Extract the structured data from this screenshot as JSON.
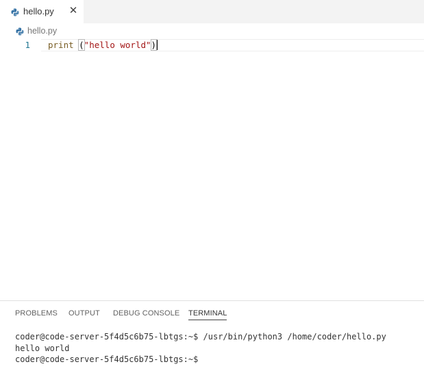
{
  "tab": {
    "filename": "hello.py",
    "close_glyph": "✕"
  },
  "breadcrumb": {
    "filename": "hello.py"
  },
  "editor": {
    "line_number": "1",
    "code": {
      "func": "print",
      "space": " ",
      "open_paren": "(",
      "string": "\"hello world\"",
      "close_paren": ")"
    }
  },
  "panel": {
    "tabs": [
      "PROBLEMS",
      "OUTPUT",
      "DEBUG CONSOLE",
      "TERMINAL"
    ],
    "active_tab": "TERMINAL"
  },
  "terminal": {
    "lines": [
      "coder@code-server-5f4d5c6b75-lbtgs:~$ /usr/bin/python3 /home/coder/hello.py",
      "hello world",
      "coder@code-server-5f4d5c6b75-lbtgs:~$"
    ]
  },
  "colors": {
    "python_blue": "#3572a5",
    "python_yellow": "#f0c040",
    "string": "#a31515",
    "function": "#795e26",
    "line_number": "#237893"
  },
  "icons": {
    "file_icon": "python-file-icon"
  }
}
